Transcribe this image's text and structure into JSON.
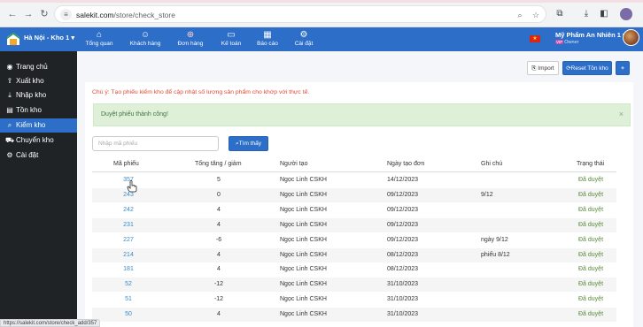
{
  "browser": {
    "url_host": "salekit.com",
    "url_path": "/store/check_store",
    "status_url": "https://salekit.com/store/check_add/357"
  },
  "header": {
    "store_select": "Hà Nội - Kho 1 ▾",
    "nav": [
      {
        "label": "Tổng quan",
        "icon": "home-icon"
      },
      {
        "label": "Khách hàng",
        "icon": "users-icon"
      },
      {
        "label": "Đơn hàng",
        "icon": "cart-icon"
      },
      {
        "label": "Kế toán",
        "icon": "card-icon"
      },
      {
        "label": "Báo cáo",
        "icon": "chart-icon"
      },
      {
        "label": "Cài đặt",
        "icon": "gear-icon"
      }
    ],
    "user_name": "Mỹ Phẩm An Nhiên 1 ▾",
    "user_role": "Owner",
    "role_badge": "VIP",
    "flag_star": "★"
  },
  "sidebar": {
    "items": [
      {
        "label": "Trang chủ",
        "icon": "dashboard-icon",
        "active": false
      },
      {
        "label": "Xuất kho",
        "icon": "export-icon",
        "active": false
      },
      {
        "label": "Nhập kho",
        "icon": "import-icon",
        "active": false
      },
      {
        "label": "Tồn kho",
        "icon": "stock-icon",
        "active": false
      },
      {
        "label": "Kiểm kho",
        "icon": "search-icon",
        "active": true
      },
      {
        "label": "Chuyển kho",
        "icon": "truck-icon",
        "active": false
      },
      {
        "label": "Cài đặt",
        "icon": "gear-icon",
        "active": false
      }
    ]
  },
  "toolbar": {
    "import_label": "Import",
    "reset_label": "Reset Tồn kho",
    "add_label": "+"
  },
  "note": "Chú ý: Tạo phiếu kiểm kho để cập nhật số lượng sản phẩm cho khớp với thực tế.",
  "alert": {
    "message": "Duyệt phiếu thành công!",
    "close": "×"
  },
  "search": {
    "placeholder": "Nhập mã phiếu",
    "button_label": "Tìm thấy"
  },
  "table": {
    "columns": [
      "Mã phiếu",
      "Tổng tăng / giảm",
      "Người tạo",
      "Ngày tạo đơn",
      "Ghi chú",
      "Trạng thái"
    ],
    "rows": [
      {
        "code": "357",
        "total": "5",
        "creator": "Ngọc Linh CSKH",
        "date": "14/12/2023",
        "note": "",
        "status": "Đã duyệt"
      },
      {
        "code": "243",
        "total": "0",
        "creator": "Ngọc Linh CSKH",
        "date": "09/12/2023",
        "note": "9/12",
        "status": "Đã duyệt"
      },
      {
        "code": "242",
        "total": "4",
        "creator": "Ngọc Linh CSKH",
        "date": "09/12/2023",
        "note": "",
        "status": "Đã duyệt"
      },
      {
        "code": "231",
        "total": "4",
        "creator": "Ngọc Linh CSKH",
        "date": "09/12/2023",
        "note": "",
        "status": "Đã duyệt"
      },
      {
        "code": "227",
        "total": "-6",
        "creator": "Ngọc Linh CSKH",
        "date": "09/12/2023",
        "note": "ngày 9/12",
        "status": "Đã duyệt"
      },
      {
        "code": "214",
        "total": "4",
        "creator": "Ngọc Linh CSKH",
        "date": "08/12/2023",
        "note": "phiếu 8/12",
        "status": "Đã duyệt"
      },
      {
        "code": "181",
        "total": "4",
        "creator": "Ngọc Linh CSKH",
        "date": "08/12/2023",
        "note": "",
        "status": "Đã duyệt"
      },
      {
        "code": "52",
        "total": "-12",
        "creator": "Ngọc Linh CSKH",
        "date": "31/10/2023",
        "note": "",
        "status": "Đã duyệt"
      },
      {
        "code": "51",
        "total": "-12",
        "creator": "Ngọc Linh CSKH",
        "date": "31/10/2023",
        "note": "",
        "status": "Đã duyệt"
      },
      {
        "code": "50",
        "total": "4",
        "creator": "Ngọc Linh CSKH",
        "date": "31/10/2023",
        "note": "",
        "status": "Đã duyệt"
      }
    ]
  },
  "colors": {
    "primary": "#2d6ec8",
    "sidebar": "#1f2326",
    "alert_bg": "#dff0d8",
    "warning_text": "#dd4b39",
    "status_text": "#5a8a3a"
  }
}
